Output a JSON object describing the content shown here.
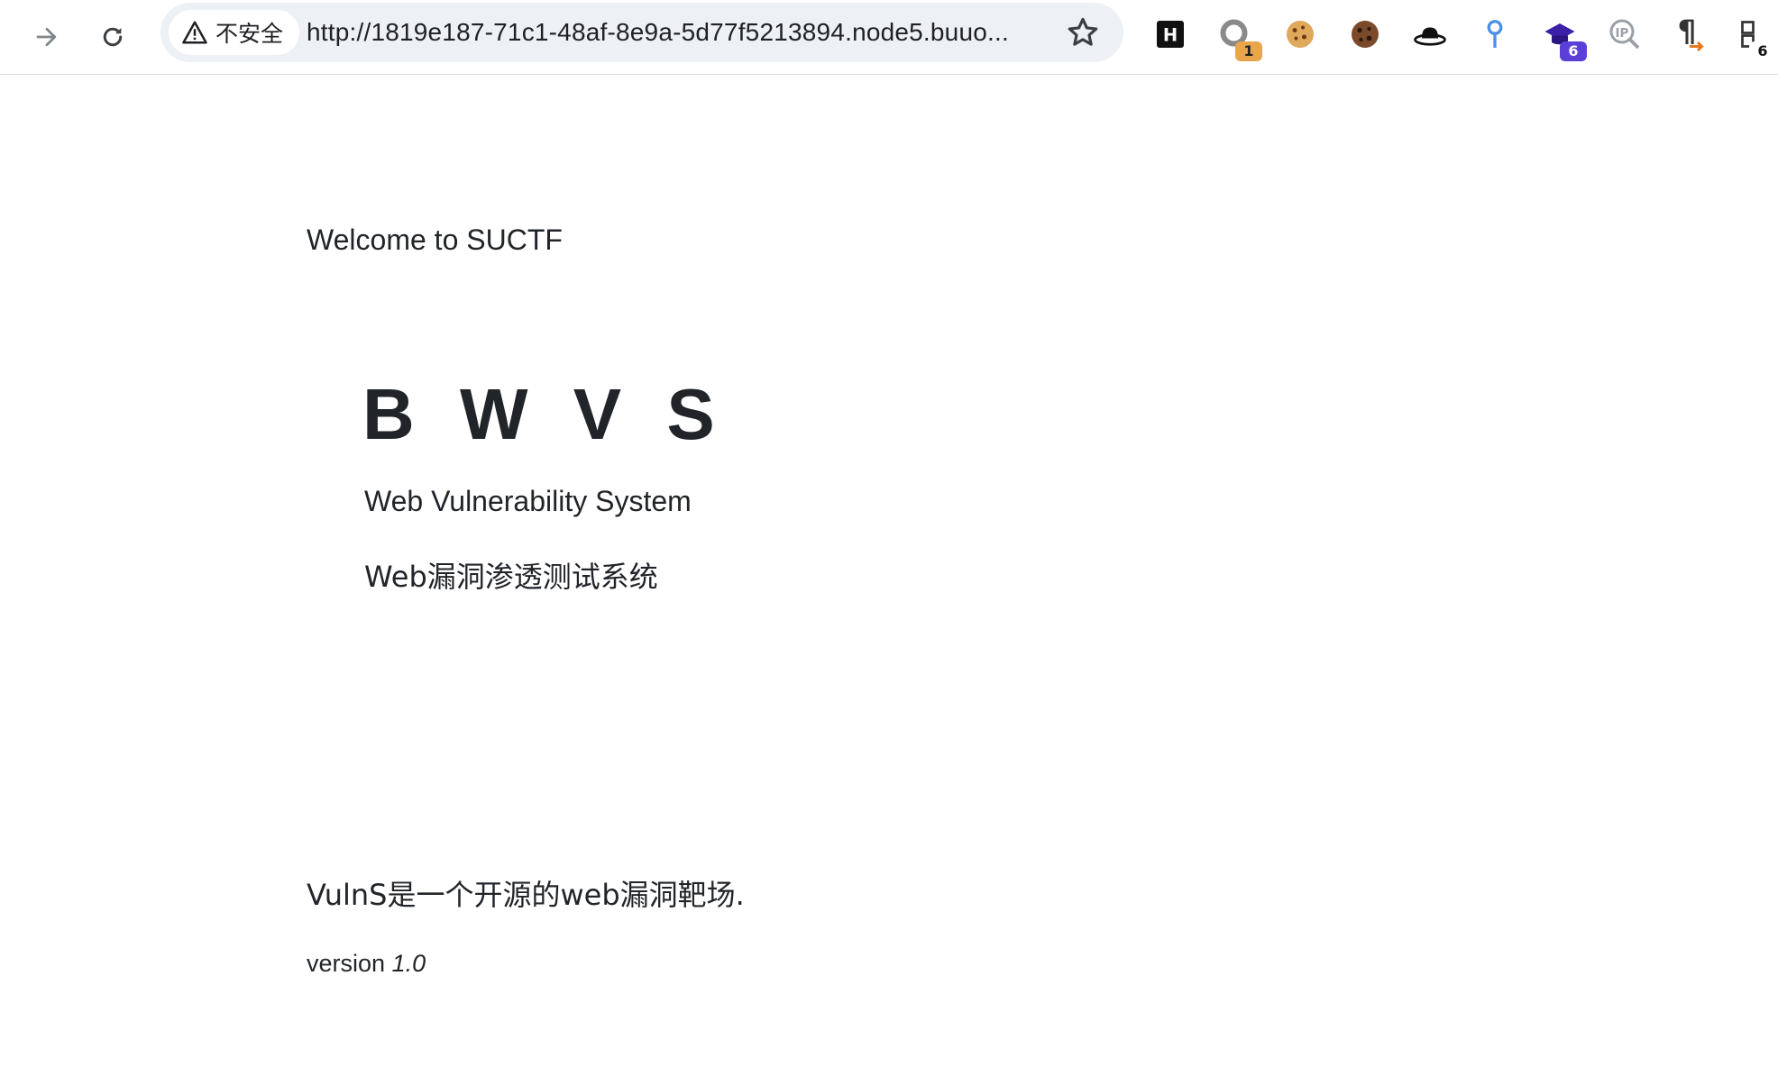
{
  "browser": {
    "security_label": "不安全",
    "url": "http://1819e187-71c1-48af-8e9a-5d77f5213894.node5.buuo...",
    "extensions": [
      {
        "name": "h-icon"
      },
      {
        "name": "ring-icon",
        "badge": "1"
      },
      {
        "name": "cookie-icon"
      },
      {
        "name": "dark-cookie-icon"
      },
      {
        "name": "hat-icon"
      },
      {
        "name": "pin-icon"
      },
      {
        "name": "cap-icon",
        "badge": "6"
      },
      {
        "name": "ip-search-icon"
      },
      {
        "name": "pilcrow-icon"
      },
      {
        "name": "extension-more-icon",
        "badge": "6"
      }
    ]
  },
  "page": {
    "welcome": "Welcome to SUCTF",
    "title": "B W V S",
    "subtitle_en": "Web Vulnerability System",
    "subtitle_cn": "Web漏洞渗透测试系统",
    "description": "VulnS是一个开源的web漏洞靶场.",
    "version_label": "version",
    "version_number": "1.0"
  },
  "colors": {
    "text": "#212529",
    "omnibox_bg": "#edf0f5",
    "badge_orange": "#e8a54c",
    "badge_purple": "#5b3fd6"
  }
}
